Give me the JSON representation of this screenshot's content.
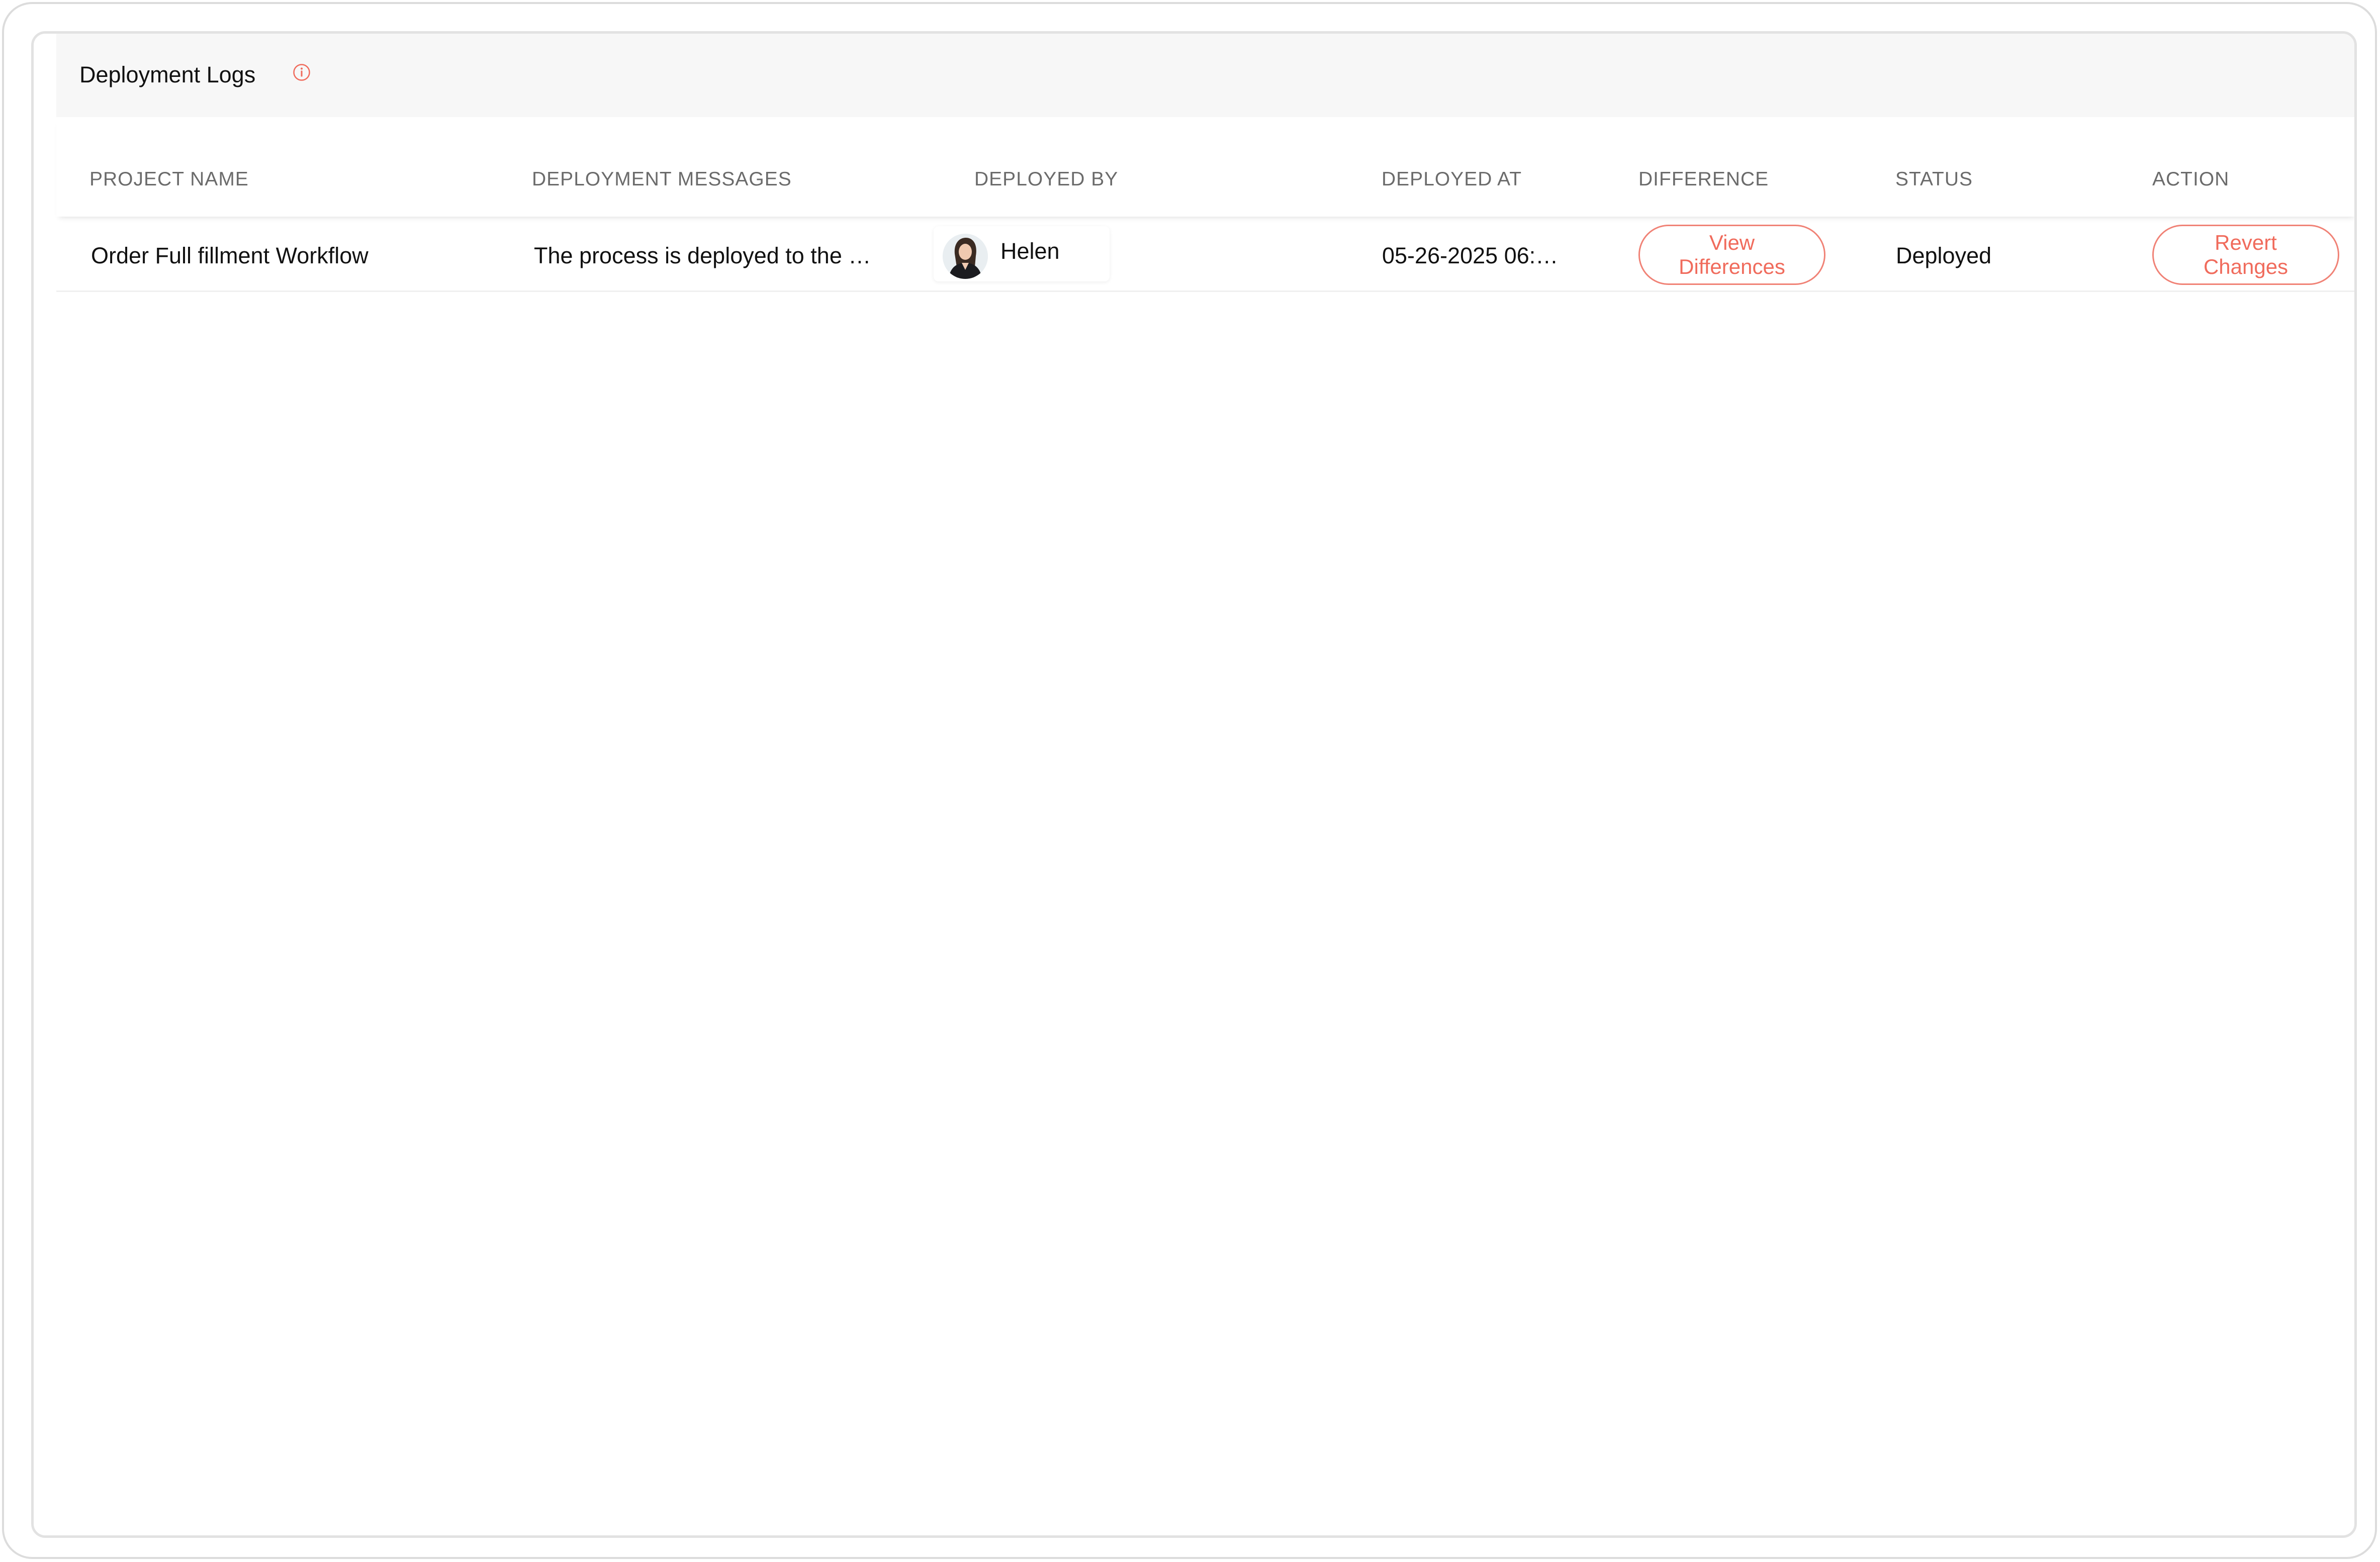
{
  "panel": {
    "title": "Deployment Logs",
    "info_icon": "info-circle-icon"
  },
  "table": {
    "columns": [
      "PROJECT NAME",
      "DEPLOYMENT MESSAGES",
      "DEPLOYED BY",
      "DEPLOYED AT",
      "DIFFERENCE",
      "STATUS",
      "ACTION"
    ],
    "rows": [
      {
        "project_name": "Order Full fillment Workflow",
        "message": "The process is deployed to the …",
        "deployed_by": "Helen",
        "deployed_at": "05-26-2025 06:…",
        "difference_button": [
          "View",
          "Differences"
        ],
        "status": "Deployed",
        "action_button": [
          "Revert",
          "Changes"
        ]
      }
    ]
  },
  "colors": {
    "accent": "#f06b5c",
    "header_bg": "#f7f7f7",
    "column_header_text": "#6b6b6b"
  }
}
